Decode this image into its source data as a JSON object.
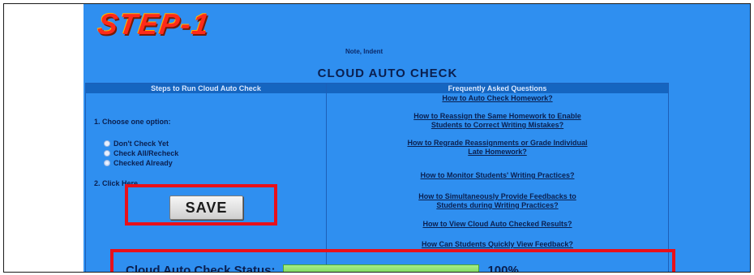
{
  "header": {
    "step_title": "STEP-1",
    "subtitle": "Note, Indent",
    "main_title": "CLOUD AUTO CHECK"
  },
  "table": {
    "left_header": "Steps to Run Cloud Auto Check",
    "right_header": "Frequently Asked Questions",
    "step1_label": "1. Choose one option:",
    "options": [
      {
        "label": "Don't Check Yet",
        "checked": false
      },
      {
        "label": "Check All/Recheck",
        "checked": false
      },
      {
        "label": "Checked Already",
        "checked": true
      }
    ],
    "step2_label": "2. Click Here",
    "save_label": "SAVE",
    "faq": [
      {
        "text": "How to Auto Check Homework?"
      },
      {
        "text": "How to Reassign the Same Homework to Enable"
      },
      {
        "text": "Students to Correct Writing Mistakes?"
      },
      {
        "text": "How to Regrade Reassignments or Grade Individual"
      },
      {
        "text": "Late Homework?"
      },
      {
        "text": "How to Monitor Students' Writing Practices?"
      },
      {
        "text": "How to Simultaneously Provide Feedbacks to"
      },
      {
        "text": "Students during Writing Practices?"
      },
      {
        "text": "How to View Cloud Auto Checked Results?"
      },
      {
        "text": "How Can Students Quickly View Feedback?"
      }
    ]
  },
  "status": {
    "label": "Cloud Auto Check Status:",
    "progress_fraction": 1.0,
    "progress_text": "100%"
  },
  "colors": {
    "panel_bg": "#2f8ff0",
    "header_bg": "#1565c0",
    "highlight": "#e8101a",
    "progress": "#86e06a"
  }
}
